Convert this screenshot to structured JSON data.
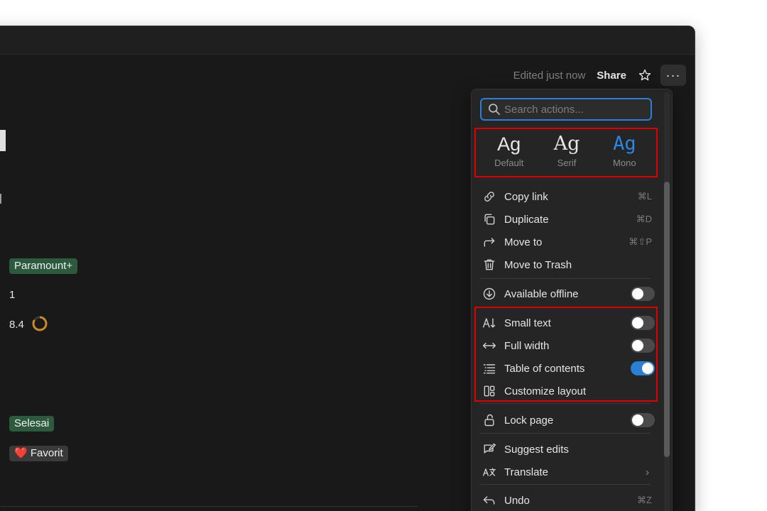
{
  "topbar": {
    "edited": "Edited just now",
    "share": "Share",
    "more": "···"
  },
  "properties": {
    "streaming_tag": "Paramount+",
    "count_value": "1",
    "rating_value": "8.4",
    "rating_progress": 0.84,
    "status_tag": "Selesai",
    "favorite_tag": "❤️ Favorit"
  },
  "menu": {
    "search_placeholder": "Search actions...",
    "fonts": [
      {
        "sample": "Ag",
        "label": "Default"
      },
      {
        "sample": "Ag",
        "label": "Serif"
      },
      {
        "sample": "Ag",
        "label": "Mono"
      }
    ],
    "selected_font": "Mono",
    "items": {
      "copy_link": {
        "label": "Copy link",
        "shortcut": "⌘L"
      },
      "duplicate": {
        "label": "Duplicate",
        "shortcut": "⌘D"
      },
      "move_to": {
        "label": "Move to",
        "shortcut": "⌘⇧P"
      },
      "move_to_trash": {
        "label": "Move to Trash"
      },
      "available_offline": {
        "label": "Available offline",
        "on": false
      },
      "small_text": {
        "label": "Small text",
        "on": false
      },
      "full_width": {
        "label": "Full width",
        "on": false
      },
      "table_of_contents": {
        "label": "Table of contents",
        "on": true
      },
      "customize_layout": {
        "label": "Customize layout"
      },
      "lock_page": {
        "label": "Lock page",
        "on": false
      },
      "suggest_edits": {
        "label": "Suggest edits"
      },
      "translate": {
        "label": "Translate",
        "chevron": "›"
      },
      "undo": {
        "label": "Undo",
        "shortcut": "⌘Z"
      }
    }
  },
  "colors": {
    "accent": "#2a80d5",
    "highlight": "#e00000",
    "tag_green": "#2b5a3d",
    "rating_ring": "#c98a2a"
  }
}
